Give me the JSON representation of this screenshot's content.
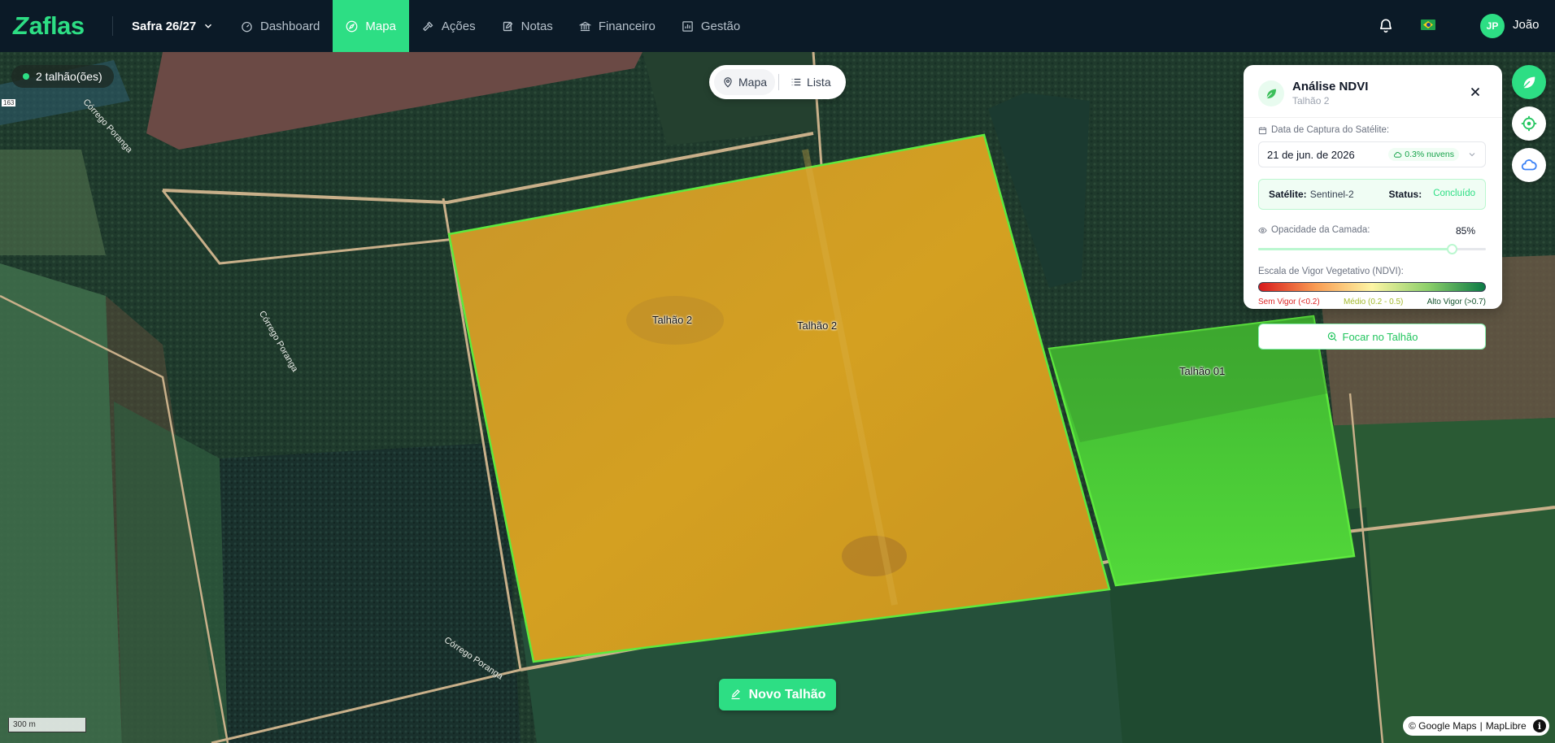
{
  "brand": {
    "logo_text": "aflas",
    "logo_mark": "Z"
  },
  "header": {
    "season_label": "Safra 26/27",
    "nav": [
      {
        "label": "Dashboard",
        "icon": "gauge-icon"
      },
      {
        "label": "Mapa",
        "icon": "compass-icon",
        "active": true
      },
      {
        "label": "Ações",
        "icon": "hammer-icon"
      },
      {
        "label": "Notas",
        "icon": "edit-icon"
      },
      {
        "label": "Financeiro",
        "icon": "bank-icon"
      },
      {
        "label": "Gestão",
        "icon": "chart-icon"
      }
    ],
    "user_initials": "JP",
    "user_name": "João",
    "flag": "brazil-flag"
  },
  "map": {
    "field_count": "2 talhão(ões)",
    "view_toggle": {
      "map_label": "Mapa",
      "list_label": "Lista"
    },
    "field_labels": [
      "Talhão 2",
      "Talhão 2",
      "Talhão 01"
    ],
    "river_labels": [
      "Córrego Poranga",
      "Córrego Poranga",
      "Córrego Poranga"
    ],
    "road_marker": "163",
    "new_field_label": "Novo Talhão",
    "scale_label": "300 m",
    "attribution_google": "© Google Maps",
    "attribution_sep": "|",
    "attribution_maplibre": "MapLibre",
    "info_symbol": "i",
    "colors": {
      "accent": "#2dde84",
      "ndvi_field": "#d4a021",
      "green_field": "#47d13a",
      "field_outline": "#5eea3e"
    }
  },
  "ndvi_panel": {
    "title": "Análise NDVI",
    "subtitle": "Talhão 2",
    "capture_label": "Data de Captura do Satélite:",
    "capture_date": "21 de jun. de 2026",
    "clouds": "0.3% nuvens",
    "satellite_key": "Satélite:",
    "satellite_value": "Sentinel-2",
    "status_key": "Status:",
    "status_value": "Concluído",
    "opacity_label": "Opacidade da Camada:",
    "opacity_value": "85%",
    "opacity_fraction": 0.85,
    "scale_label": "Escala de Vigor Vegetativo (NDVI):",
    "legend_low": "Sem Vigor (<0.2)",
    "legend_mid": "Médio (0.2 - 0.5)",
    "legend_high": "Alto Vigor (>0.7)",
    "focus_button": "Focar no Talhão"
  }
}
